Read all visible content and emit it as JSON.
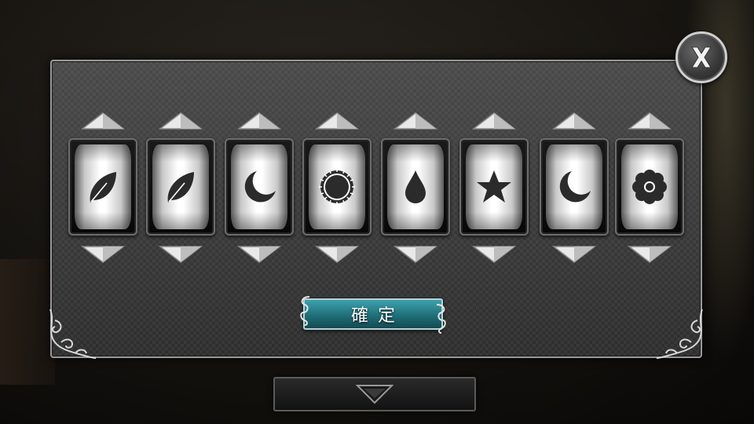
{
  "dialog": {
    "confirm_label": "確定",
    "close_icon": "close-x-icon",
    "bottom_icon": "chevron-down-icon",
    "accent_color": "#2a8792"
  },
  "reels": [
    {
      "symbol": "leaf",
      "icon": "leaf-icon"
    },
    {
      "symbol": "leaf",
      "icon": "leaf-icon"
    },
    {
      "symbol": "moon",
      "icon": "moon-icon"
    },
    {
      "symbol": "sun",
      "icon": "sun-icon"
    },
    {
      "symbol": "drop",
      "icon": "drop-icon"
    },
    {
      "symbol": "star",
      "icon": "star-icon"
    },
    {
      "symbol": "moon",
      "icon": "moon-icon"
    },
    {
      "symbol": "flower",
      "icon": "flower-icon"
    }
  ]
}
